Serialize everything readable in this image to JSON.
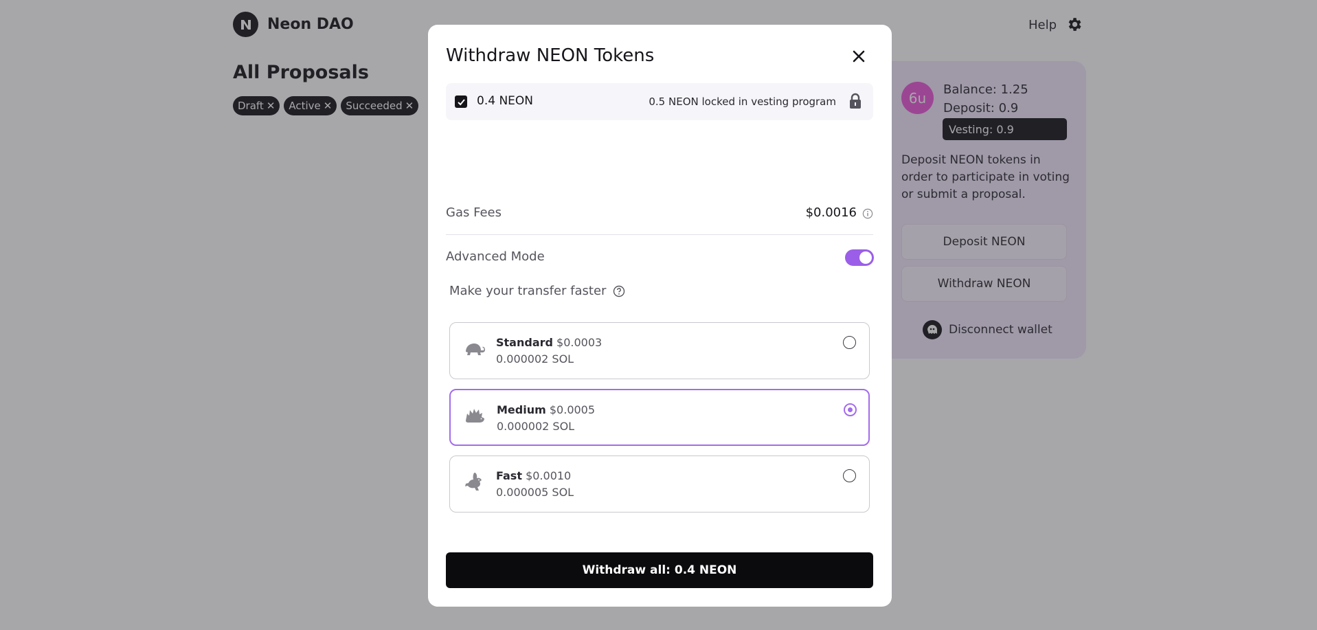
{
  "header": {
    "brand": "Neon DAO",
    "help_label": "Help",
    "settings_icon": "gear-icon"
  },
  "main": {
    "title": "All Proposals",
    "filters": [
      "Draft",
      "Active",
      "Succeeded"
    ]
  },
  "account": {
    "avatar_text": "6u",
    "avatar_color": "#e94fd6",
    "balance": "Balance: 1.25",
    "deposit": "Deposit: 0.9",
    "vesting": "Vesting: 0.9",
    "description": "Deposit NEON tokens in order to participate in voting or submit a proposal.",
    "deposit_button": "Deposit NEON",
    "withdraw_button": "Withdraw NEON",
    "disconnect": "Disconnect wallet"
  },
  "modal": {
    "title": "Withdraw NEON Tokens",
    "token_amount": "0.4 NEON",
    "token_checked": true,
    "locked_note": "0.5 NEON locked in vesting program",
    "gas_label": "Gas Fees",
    "gas_value": "$0.0016",
    "advanced_label": "Advanced Mode",
    "advanced_enabled": true,
    "faster_label": "Make your transfer faster",
    "options": [
      {
        "name": "Standard",
        "price": "$0.0003",
        "sol": "0.000002 SOL",
        "icon": "turtle-icon",
        "selected": false
      },
      {
        "name": "Medium",
        "price": "$0.0005",
        "sol": "0.000002 SOL",
        "icon": "hedgehog-icon",
        "selected": true
      },
      {
        "name": "Fast",
        "price": "$0.0010",
        "sol": "0.000005 SOL",
        "icon": "rabbit-icon",
        "selected": false
      }
    ],
    "withdraw_all_label": "Withdraw all: 0.4 NEON"
  },
  "colors": {
    "accent": "#a36bec",
    "primary_button": "#0b0a0d",
    "side_card_bg": "#f2e6fb"
  }
}
